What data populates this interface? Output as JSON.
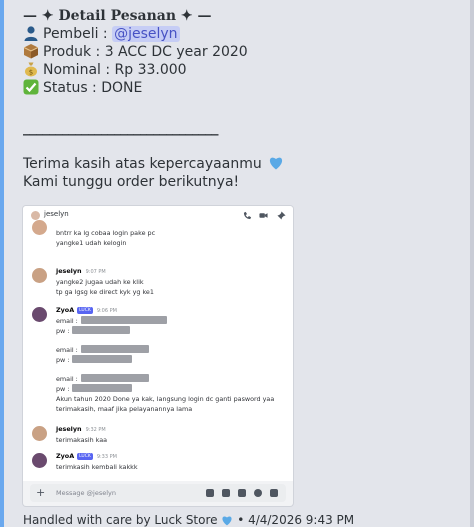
{
  "embed": {
    "title": "— ✦ Detail Pesanan ✦ —",
    "buyer_label": "Pembeli :",
    "buyer_mention": "@jeselyn",
    "product_label": "Produk : 3 ACC DC year 2020",
    "nominal_label": "Nominal : Rp 33.000",
    "status_label": "Status : DONE",
    "divider": "______________________________",
    "thanks_line": "Terima kasih atas kepercayaanmu",
    "order_line": "Kami tunggu order berikutnya!",
    "footer_text": "Handled with care by Luck Store",
    "footer_time": "• 4/4/2026 9:43 PM",
    "accent_color": "#6aa8ee"
  },
  "screenshot": {
    "header_name": "jeselyn",
    "messages": [
      {
        "lines": [
          "bntrr ka lg cobaa login pake pc",
          "yangke1 udah kelogin"
        ]
      },
      {
        "name": "jeselyn",
        "time": "9:07 PM",
        "lines": [
          "yangke2 jugaa udah ke klik",
          "tp ga lgsg ke direct kyk yg ke1"
        ]
      },
      {
        "name": "ZyoA",
        "tag": "LUCK",
        "time": "9:06 PM",
        "lines": [
          "email :",
          "pw :",
          "email :",
          "pw :",
          "email :",
          "pw :",
          "Akun tahun 2020 Done ya kak, langsung login dc ganti pasword yaa",
          "terimakasih, maaf jika pelayanannya lama"
        ]
      },
      {
        "name": "jeselyn",
        "time": "9:32 PM",
        "lines": [
          "terimakasih kaa"
        ]
      },
      {
        "name": "ZyoA",
        "tag": "LUCK",
        "time": "9:33 PM",
        "lines": [
          "terimkasih kembali kakkk"
        ]
      }
    ],
    "composer_placeholder": "Message @jeselyn"
  }
}
